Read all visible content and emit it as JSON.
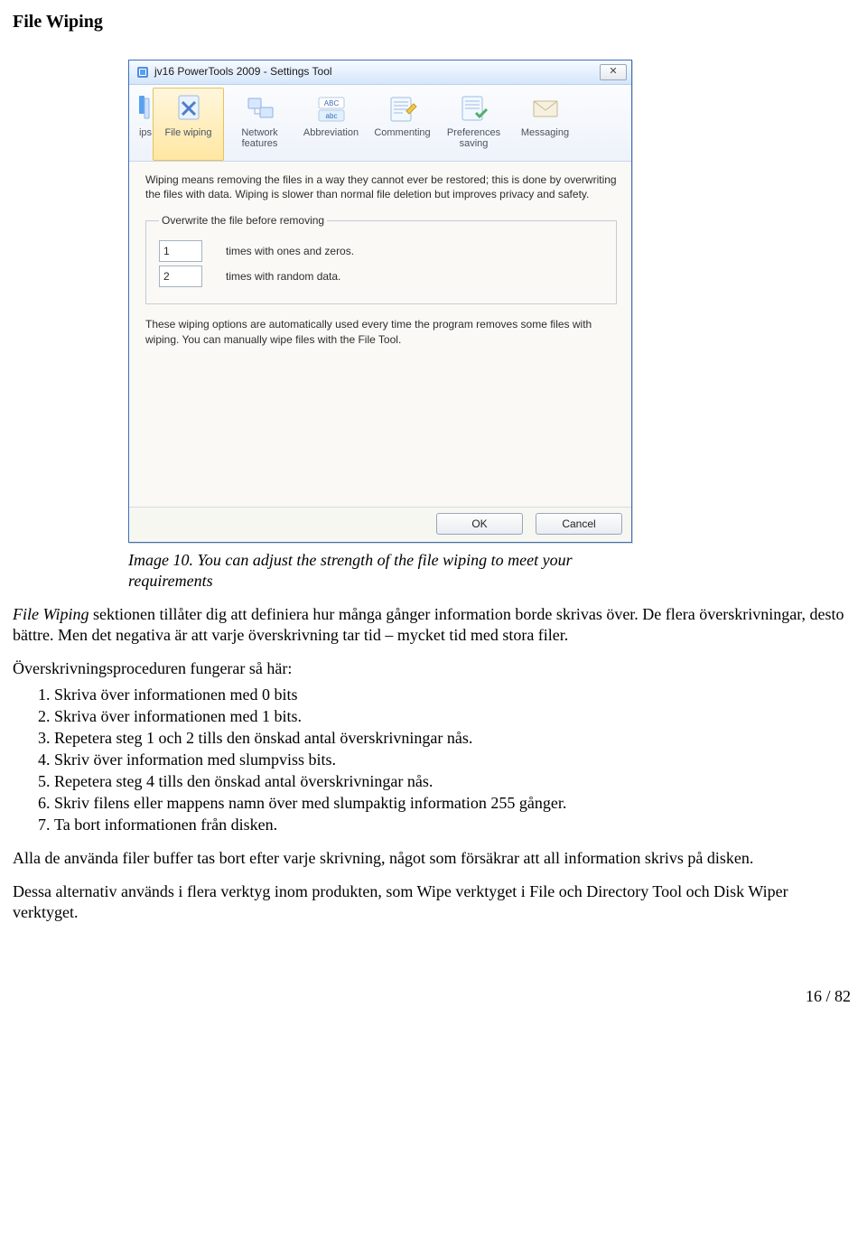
{
  "section_heading": "File Wiping",
  "caption": "Image 10. You can adjust the strength of the file wiping to meet your requirements",
  "window": {
    "title": "jv16 PowerTools 2009 - Settings Tool",
    "close_glyph": "✕",
    "toolbar": [
      {
        "id": "ips",
        "label": "ips",
        "sub": ""
      },
      {
        "id": "file-wiping",
        "label": "File wiping",
        "sub": ""
      },
      {
        "id": "network",
        "label": "Network",
        "sub": "features"
      },
      {
        "id": "abbreviation",
        "label": "Abbreviation",
        "sub": ""
      },
      {
        "id": "commenting",
        "label": "Commenting",
        "sub": ""
      },
      {
        "id": "preferences",
        "label": "Preferences",
        "sub": "saving"
      },
      {
        "id": "messaging",
        "label": "Messaging",
        "sub": ""
      }
    ],
    "description": "Wiping means removing the files in a way they cannot ever be restored; this is done by overwriting the files with data. Wiping is slower than normal file deletion but improves privacy and safety.",
    "group_legend": "Overwrite the file before removing",
    "row1_value": "1",
    "row1_label": "times with ones and zeros.",
    "row2_value": "2",
    "row2_label": "times with random data.",
    "note": "These wiping options are automatically used every time the program removes some files with wiping. You can manually wipe files with the File Tool.",
    "ok_label": "OK",
    "cancel_label": "Cancel"
  },
  "body": {
    "intro_italic": "File Wiping",
    "intro_rest": " sektionen tillåter dig att definiera hur många gånger information borde skrivas över. De flera överskrivningar, desto bättre. Men det negativa är att varje överskrivning tar tid – mycket tid med stora filer.",
    "proc_heading": "Överskrivningsproceduren fungerar så här:",
    "steps": [
      "Skriva över informationen med 0 bits",
      "Skriva över informationen med 1 bits.",
      "Repetera steg 1 och 2 tills den önskad antal överskrivningar nås.",
      "Skriv över information med slumpviss bits.",
      "Repetera steg 4 tills den önskad antal överskrivningar nås.",
      "Skriv filens eller mappens namn över med slumpaktig information 255 gånger.",
      "Ta bort informationen från disken."
    ],
    "para2": "Alla de använda filer buffer tas bort efter varje skrivning, något som försäkrar att all information skrivs på disken.",
    "para3": "Dessa alternativ används i flera verktyg inom produkten, som Wipe verktyget i File och Directory Tool och Disk Wiper verktyget."
  },
  "page_number": "16 / 82"
}
